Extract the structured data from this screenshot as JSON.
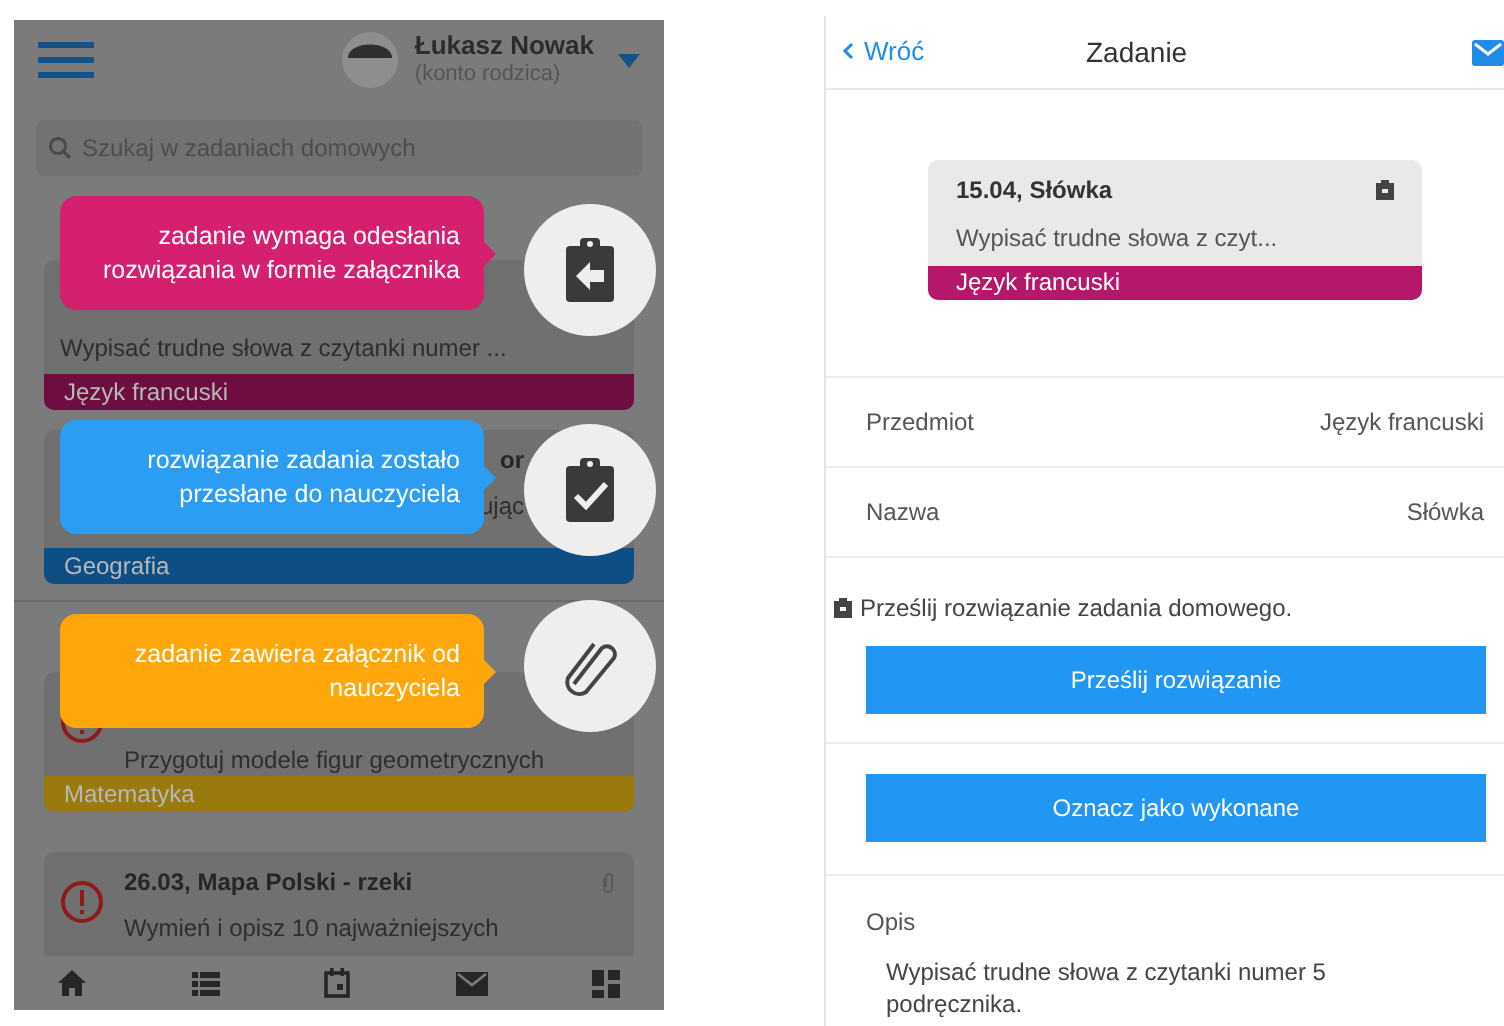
{
  "homework_list": {
    "user": {
      "name": "Łukasz Nowak",
      "role": "(konto rodzica)"
    },
    "search": {
      "placeholder": "Szukaj w zadaniach domowych"
    },
    "cards": [
      {
        "description": "Wypisać trudne słowa z czytanki numer ...",
        "subject": "Język francuski",
        "color": "#6e0d40"
      },
      {
        "title": "or",
        "description": "ując",
        "subject": "Geografia",
        "color": "#0d4f85"
      },
      {
        "description": "Przygotuj modele figur geometrycznych",
        "subject": "Matematyka",
        "color": "#9a7a0c",
        "alert": true
      },
      {
        "title": "26.03, Mapa Polski - rzeki",
        "description": "Wymień i opisz 10 najważniejszych",
        "alert": true,
        "attachment": true
      }
    ],
    "tooltips": [
      {
        "kind": "send_back",
        "text": "zadanie wymaga odesłania rozwiązania w formie załącznika",
        "color": "#d4206f"
      },
      {
        "kind": "submitted",
        "text": "rozwiązanie zadania zostało przesłane do nauczyciela",
        "color": "#2b9df2"
      },
      {
        "kind": "attachment",
        "text": "zadanie zawiera załącznik od nauczyciela",
        "color": "#ffa70a"
      }
    ]
  },
  "task_detail": {
    "back": "Wróć",
    "title": "Zadanie",
    "preview": {
      "title": "15.04, Słówka",
      "description": "Wypisać trudne słowa z czyt...",
      "subject": "Język francuski",
      "color": "#b5176a"
    },
    "rows": [
      {
        "label": "Przedmiot",
        "value": "Język francuski"
      },
      {
        "label": "Nazwa",
        "value": "Słówka"
      }
    ],
    "upload_note": "Prześlij rozwiązanie zadania domowego.",
    "buttons": [
      "Prześlij rozwiązanie",
      "Oznacz jako wykonane"
    ],
    "description": {
      "label": "Opis",
      "text": "Wypisać trudne słowa z czytanki numer 5 podręcznika."
    }
  }
}
